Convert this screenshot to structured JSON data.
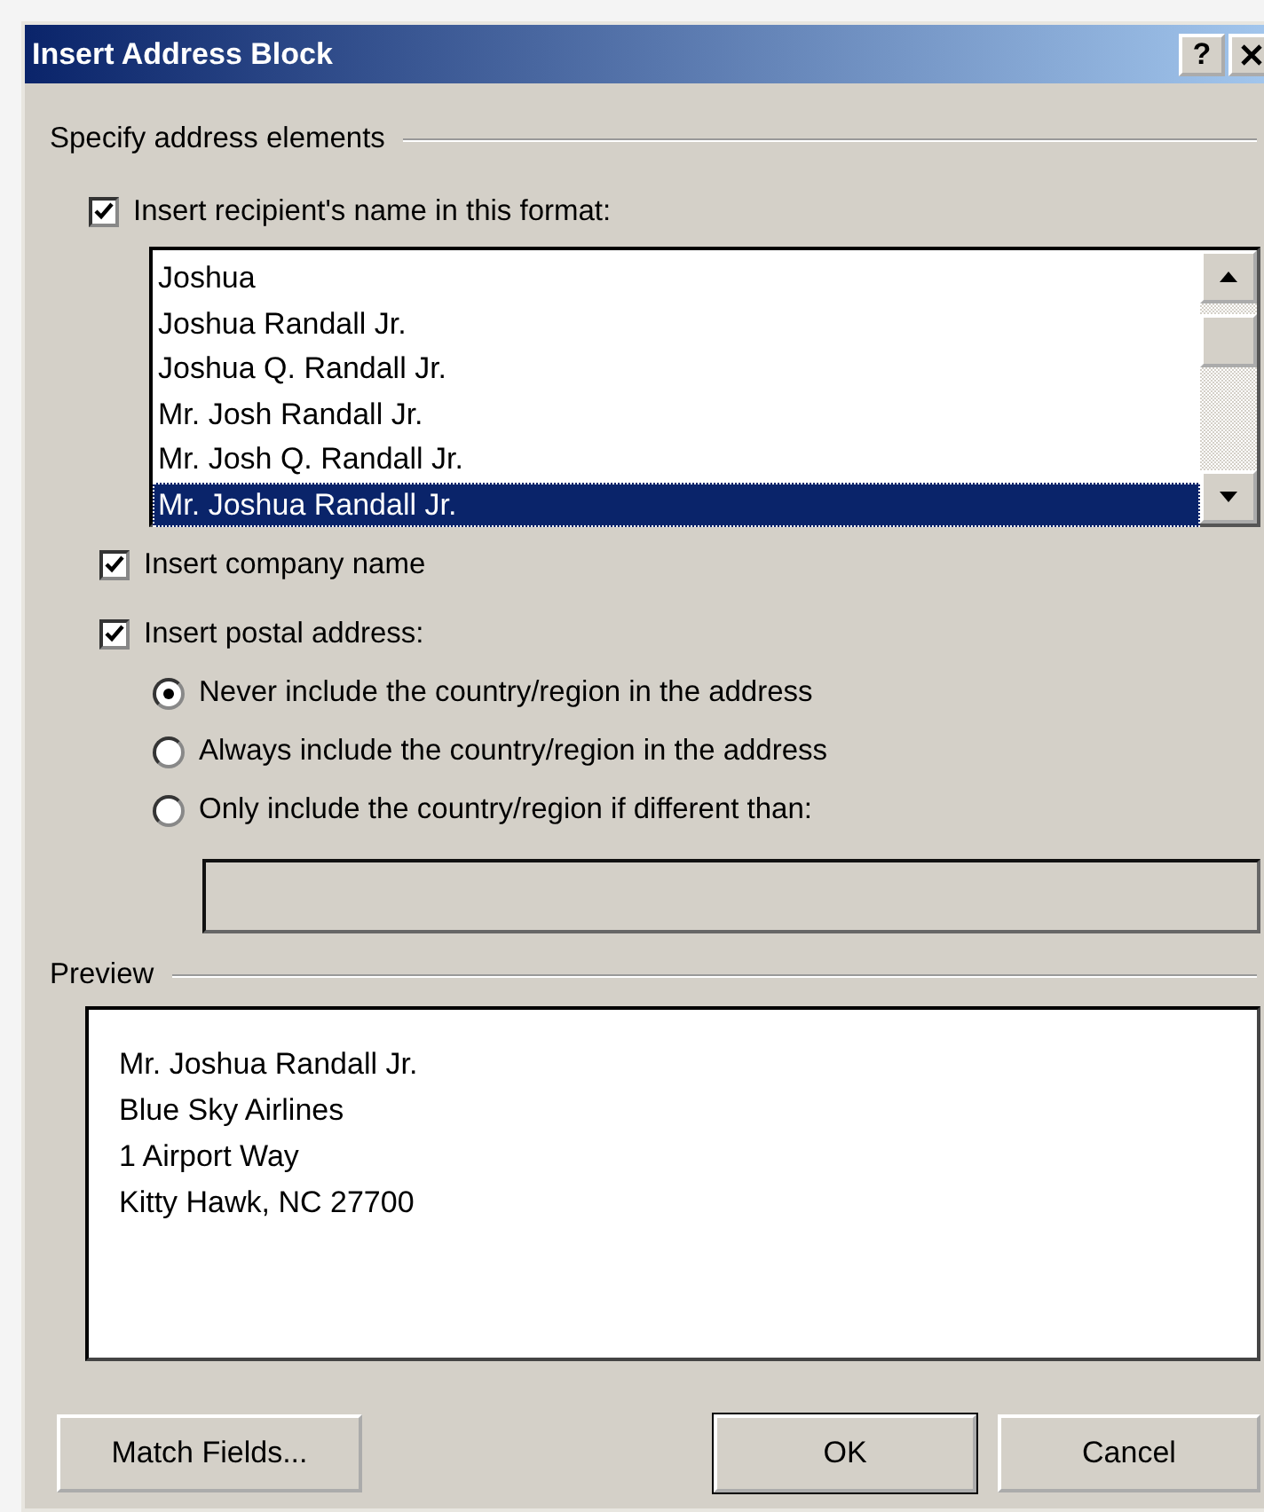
{
  "window": {
    "title": "Insert Address Block",
    "help_button": "?"
  },
  "section_title": "Specify address elements",
  "name_format": {
    "label": "Insert recipient's name in this format:",
    "checked": true,
    "items": [
      {
        "label": "Joshua",
        "selected": false
      },
      {
        "label": "Joshua Randall Jr.",
        "selected": false
      },
      {
        "label": "Joshua Q. Randall Jr.",
        "selected": false
      },
      {
        "label": "Mr. Josh Randall Jr.",
        "selected": false
      },
      {
        "label": "Mr. Josh Q. Randall Jr.",
        "selected": false
      },
      {
        "label": "Mr. Joshua Randall Jr.",
        "selected": true
      }
    ]
  },
  "company": {
    "label": "Insert company name",
    "checked": true
  },
  "postal": {
    "label": "Insert postal address:",
    "checked": true,
    "options": [
      {
        "label": "Never include the country/region in the address",
        "selected": true
      },
      {
        "label": "Always include the country/region in the address",
        "selected": false
      },
      {
        "label": "Only include the country/region if different than:",
        "selected": false
      }
    ],
    "country_field": {
      "disabled": true
    }
  },
  "preview": {
    "title": "Preview",
    "lines": [
      "Mr. Joshua Randall Jr.",
      "Blue Sky Airlines",
      "1 Airport Way",
      "Kitty Hawk, NC 27700"
    ]
  },
  "buttons": [
    {
      "label": "Match Fields...",
      "kind": "left"
    },
    {
      "label": "OK",
      "kind": "default"
    },
    {
      "label": "Cancel",
      "kind": "normal"
    }
  ]
}
